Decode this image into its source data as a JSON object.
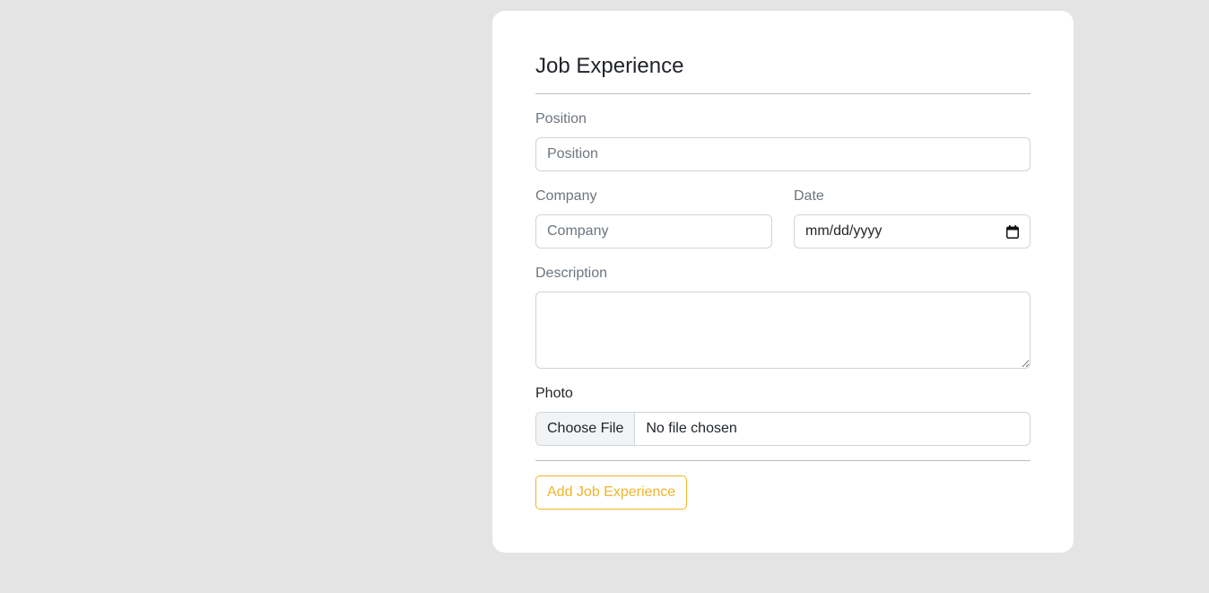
{
  "form": {
    "title": "Job Experience",
    "position": {
      "label": "Position",
      "placeholder": "Position",
      "value": ""
    },
    "company": {
      "label": "Company",
      "placeholder": "Company",
      "value": ""
    },
    "date": {
      "label": "Date",
      "display": "mm/dd/yyyy",
      "icon": "calendar-icon"
    },
    "description": {
      "label": "Description",
      "value": ""
    },
    "photo": {
      "label": "Photo",
      "button_label": "Choose File",
      "status": "No file chosen"
    },
    "submit_label": "Add Job Experience"
  },
  "colors": {
    "page_background": "#e4e4e4",
    "card_background": "#ffffff",
    "accent": "#f0b429",
    "label_muted": "#6c757d",
    "text": "#212529",
    "border": "#ced4da"
  }
}
